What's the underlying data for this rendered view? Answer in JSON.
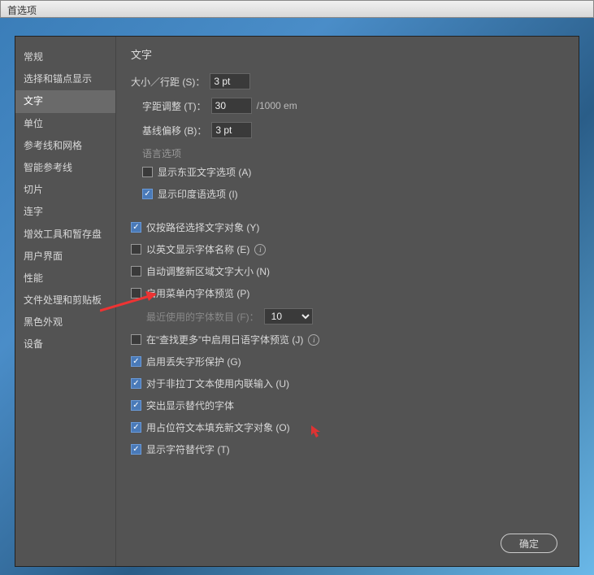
{
  "titlebar": {
    "title": "首选项"
  },
  "sidebar": {
    "items": [
      {
        "label": "常规"
      },
      {
        "label": "选择和锚点显示"
      },
      {
        "label": "文字",
        "selected": true
      },
      {
        "label": "单位"
      },
      {
        "label": "参考线和网格"
      },
      {
        "label": "智能参考线"
      },
      {
        "label": "切片"
      },
      {
        "label": "连字"
      },
      {
        "label": "增效工具和暂存盘"
      },
      {
        "label": "用户界面"
      },
      {
        "label": "性能"
      },
      {
        "label": "文件处理和剪贴板"
      },
      {
        "label": "黑色外观"
      },
      {
        "label": "设备"
      }
    ]
  },
  "main": {
    "heading": "文字",
    "size": {
      "label": "大小／行距 (S)：",
      "value": "3 pt"
    },
    "tracking": {
      "label": "字距调整 (T)：",
      "value": "30",
      "suffix": "/1000 em"
    },
    "baseline": {
      "label": "基线偏移 (B)：",
      "value": "3 pt"
    },
    "langSection": "语言选项",
    "langEastAsian": {
      "label": "显示东亚文字选项 (A)",
      "checked": false
    },
    "langIndic": {
      "label": "显示印度语选项 (I)",
      "checked": true
    },
    "opts": [
      {
        "id": "path-select",
        "label": "仅按路径选择文字对象 (Y)",
        "checked": true
      },
      {
        "id": "english-font",
        "label": "以英文显示字体名称 (E)",
        "checked": false,
        "info": true
      },
      {
        "id": "auto-size",
        "label": "自动调整新区域文字大小 (N)",
        "checked": false
      },
      {
        "id": "menu-preview",
        "label": "启用菜单内字体预览 (P)",
        "checked": false
      }
    ],
    "recentFonts": {
      "label": "最近使用的字体数目 (F)：",
      "value": "10"
    },
    "opts2": [
      {
        "id": "jp-preview",
        "label": "在“查找更多”中启用日语字体预览 (J)",
        "checked": false,
        "info": true
      },
      {
        "id": "glyph-protect",
        "label": "启用丢失字形保护 (G)",
        "checked": true
      },
      {
        "id": "inline-input",
        "label": "对于非拉丁文本使用内联输入 (U)",
        "checked": true
      },
      {
        "id": "highlight-alt",
        "label": "突出显示替代的字体",
        "checked": true
      },
      {
        "id": "placeholder-fill",
        "label": "用占位符文本填充新文字对象 (O)",
        "checked": true
      },
      {
        "id": "show-alt-glyph",
        "label": "显示字符替代字 (T)",
        "checked": true
      }
    ]
  },
  "buttons": {
    "ok": "确定"
  }
}
